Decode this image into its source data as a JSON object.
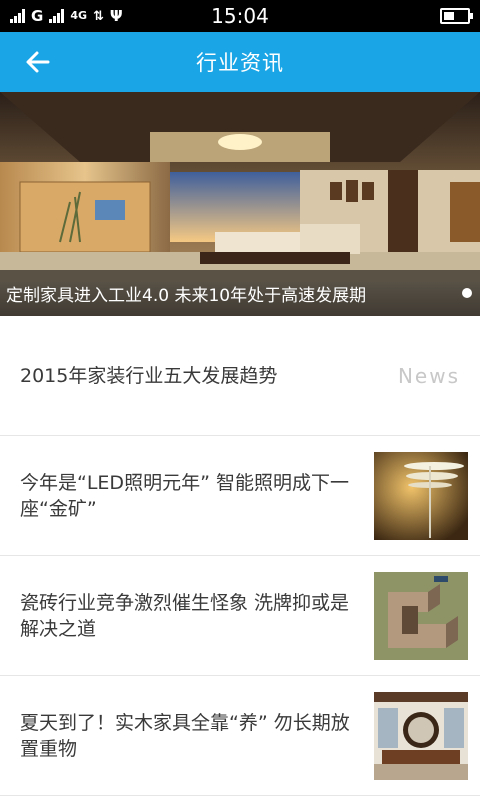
{
  "status": {
    "network_1": "G",
    "network_2": "4G",
    "time": "15:04"
  },
  "header": {
    "title": "行业资讯",
    "back_icon": "arrow-left-icon"
  },
  "banner": {
    "caption": "定制家具进入工业4.0 未来10年处于高速发展期"
  },
  "news": [
    {
      "title": "2015年家装行业五大发展趋势",
      "tag": "News"
    },
    {
      "title": "今年是“LED照明元年” 智能照明成下一座“金矿”"
    },
    {
      "title": "瓷砖行业竞争激烈催生怪象 洗牌抑或是解决之道"
    },
    {
      "title": "夏天到了！实木家具全靠“养” 勿长期放置重物"
    }
  ],
  "colors": {
    "accent": "#1aa6e6"
  }
}
